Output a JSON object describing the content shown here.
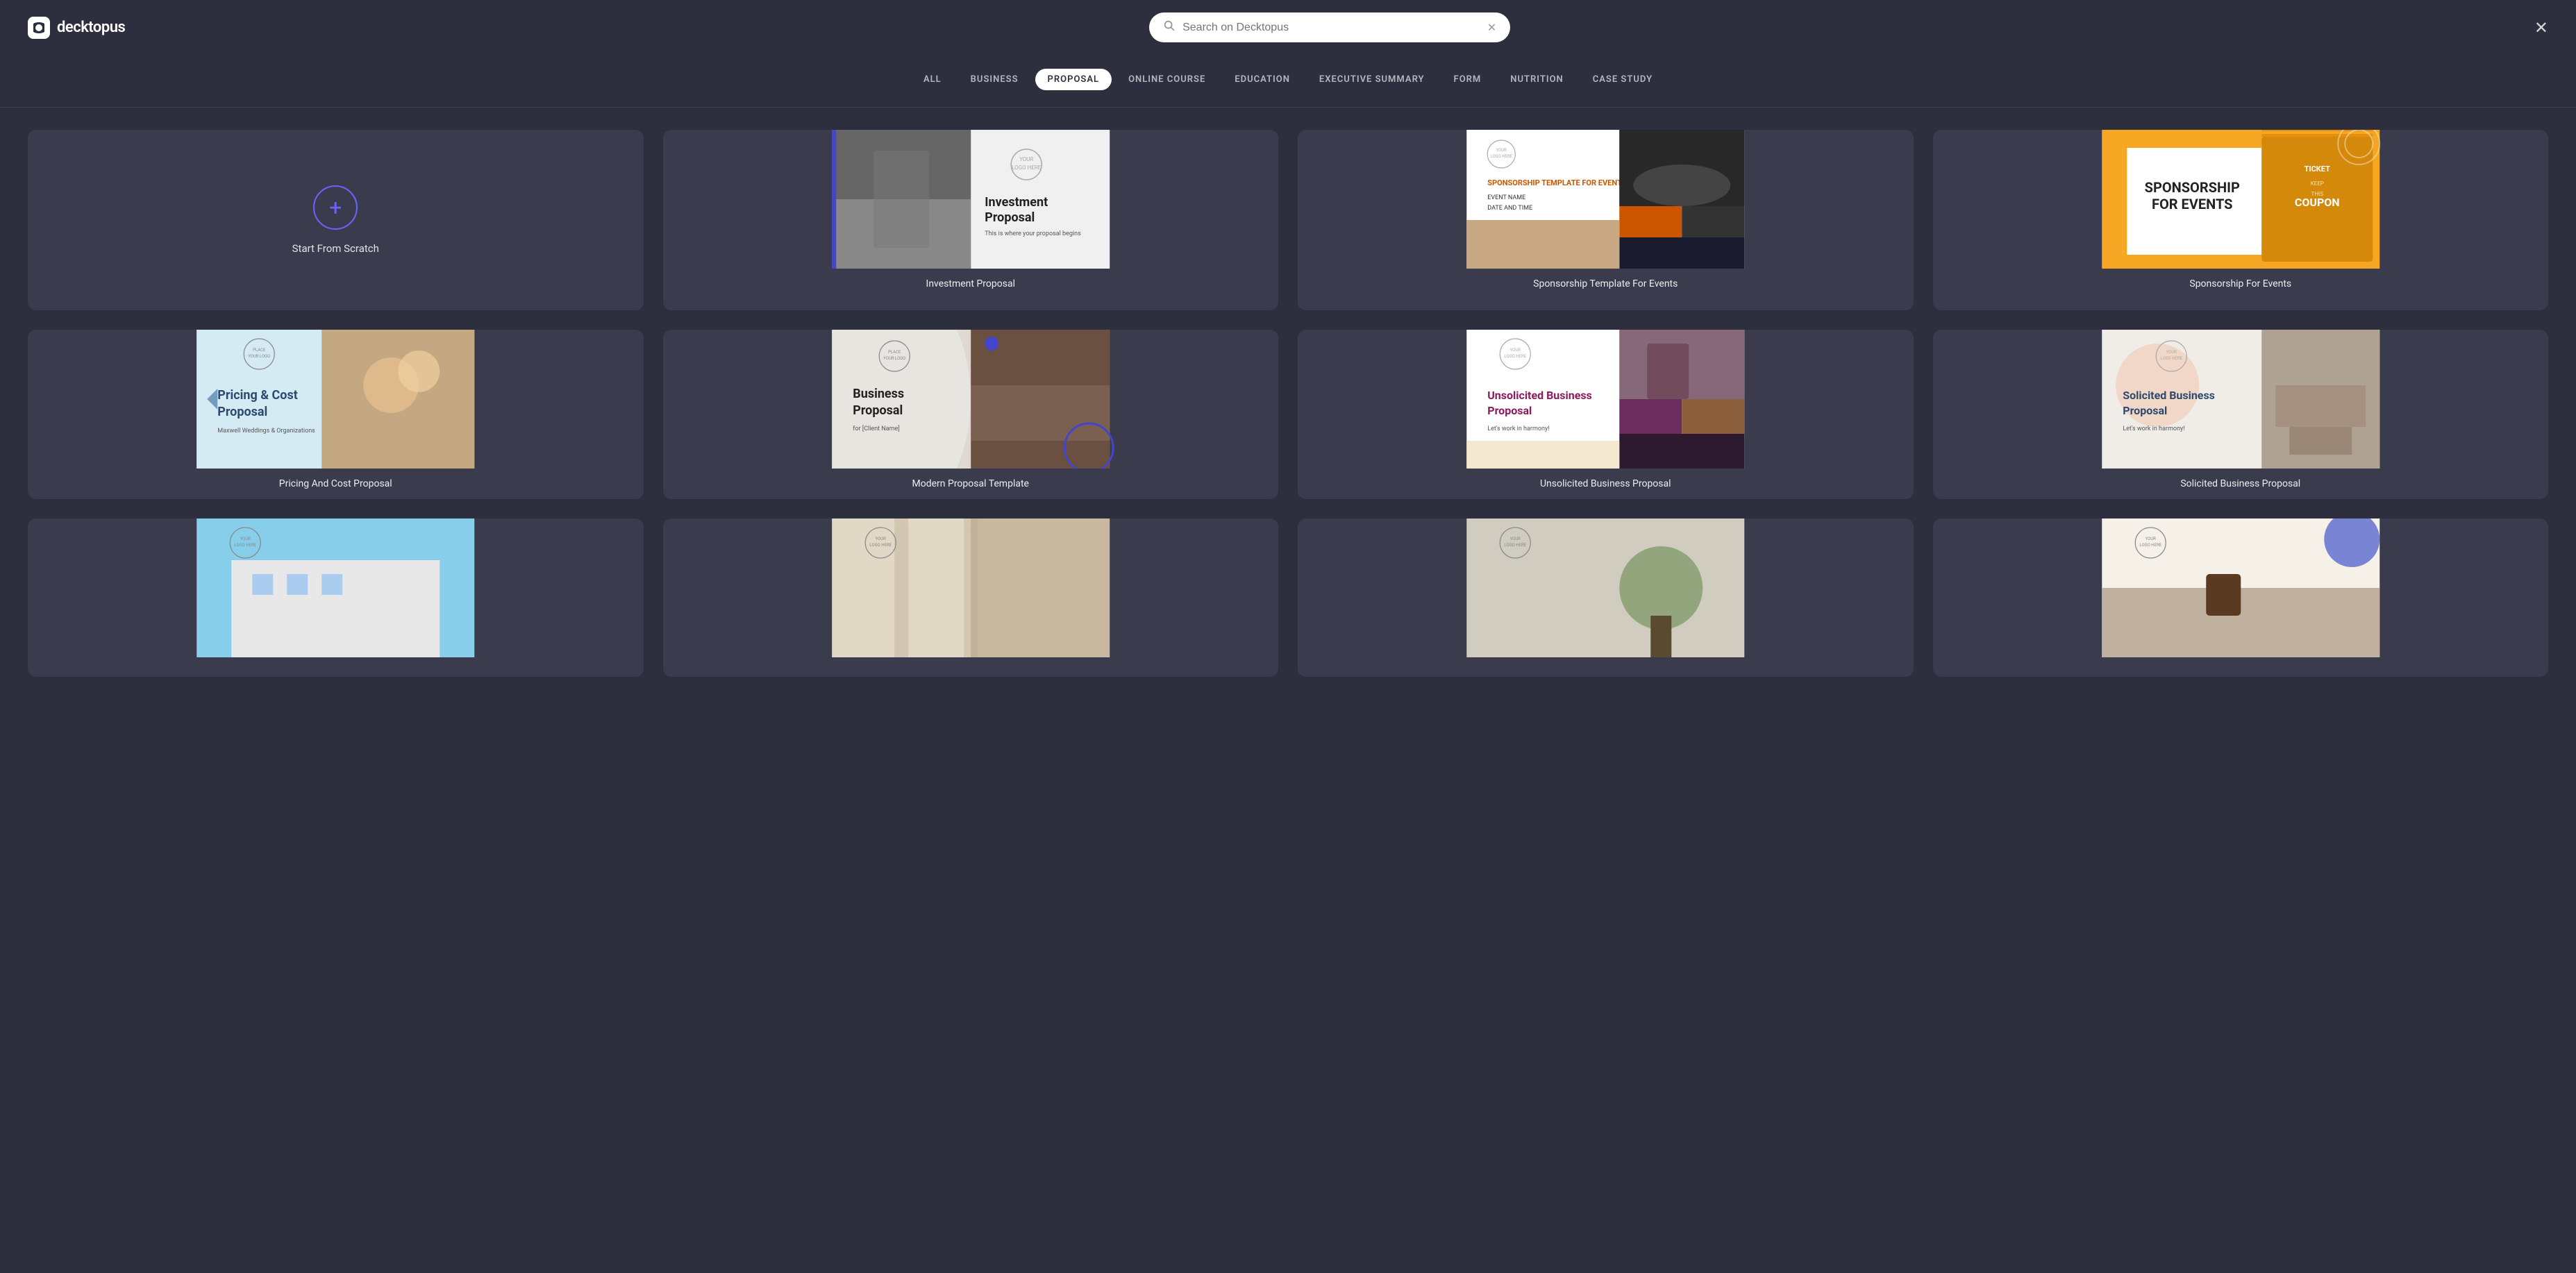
{
  "header": {
    "logo_text": "decktopus",
    "search_placeholder": "Search on Decktopus",
    "search_value": ""
  },
  "nav": {
    "tabs": [
      {
        "id": "all",
        "label": "ALL",
        "active": false
      },
      {
        "id": "business",
        "label": "BUSINESS",
        "active": false
      },
      {
        "id": "proposal",
        "label": "PROPOSAL",
        "active": true
      },
      {
        "id": "online-course",
        "label": "ONLINE COURSE",
        "active": false
      },
      {
        "id": "education",
        "label": "EDUCATION",
        "active": false
      },
      {
        "id": "executive-summary",
        "label": "EXECUTIVE SUMMARY",
        "active": false
      },
      {
        "id": "form",
        "label": "FORM",
        "active": false
      },
      {
        "id": "nutrition",
        "label": "NUTRITION",
        "active": false
      },
      {
        "id": "case-study",
        "label": "CASE STUDY",
        "active": false
      }
    ]
  },
  "scratch": {
    "label": "Start From Scratch"
  },
  "templates": [
    {
      "id": "investment-proposal",
      "label": "Investment Proposal",
      "thumb_type": "investment"
    },
    {
      "id": "sponsorship-template-events",
      "label": "Sponsorship Template For Events",
      "thumb_type": "sponsorship1"
    },
    {
      "id": "sponsorship-for-events",
      "label": "Sponsorship For Events",
      "thumb_type": "sponsorship2"
    },
    {
      "id": "pricing-cost-proposal",
      "label": "Pricing And Cost Proposal",
      "thumb_type": "pricing"
    },
    {
      "id": "modern-proposal-template",
      "label": "Modern Proposal Template",
      "thumb_type": "modern"
    },
    {
      "id": "unsolicited-business-proposal",
      "label": "Unsolicited Business Proposal",
      "thumb_type": "unsolicited"
    },
    {
      "id": "solicited-business-proposal",
      "label": "Solicited Business Proposal",
      "thumb_type": "solicited"
    },
    {
      "id": "row2-col1",
      "label": "",
      "thumb_type": "building"
    },
    {
      "id": "row2-col2",
      "label": "",
      "thumb_type": "interior"
    },
    {
      "id": "row2-col3",
      "label": "",
      "thumb_type": "plant"
    },
    {
      "id": "row2-col4",
      "label": "",
      "thumb_type": "coffee"
    }
  ]
}
